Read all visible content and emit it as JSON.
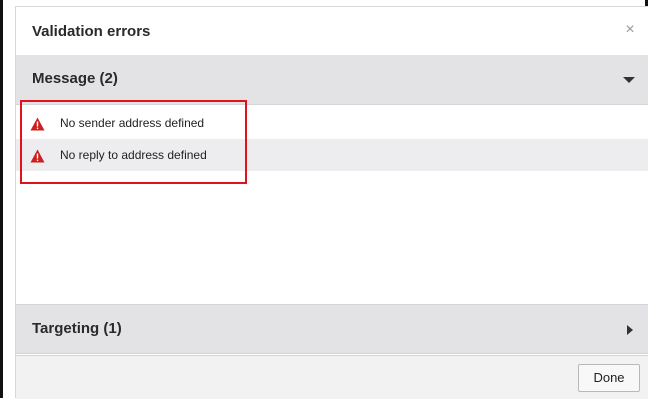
{
  "dialog": {
    "title": "Validation errors",
    "close_glyph": "×",
    "close_icon": "close-icon"
  },
  "sections": {
    "message": {
      "label": "Message (2)",
      "state": "expanded",
      "caret_icon": "caret-down-icon",
      "errors": [
        {
          "text": "No sender address defined",
          "icon": "warning-triangle-icon"
        },
        {
          "text": "No reply to address defined",
          "icon": "warning-triangle-icon"
        }
      ]
    },
    "targeting": {
      "label": "Targeting (1)",
      "state": "collapsed",
      "caret_icon": "caret-right-icon"
    }
  },
  "footer": {
    "done_label": "Done"
  },
  "colors": {
    "error_icon": "#cc1f1f",
    "highlight_border": "#e0121b",
    "section_header_bg": "#e3e3e6"
  }
}
